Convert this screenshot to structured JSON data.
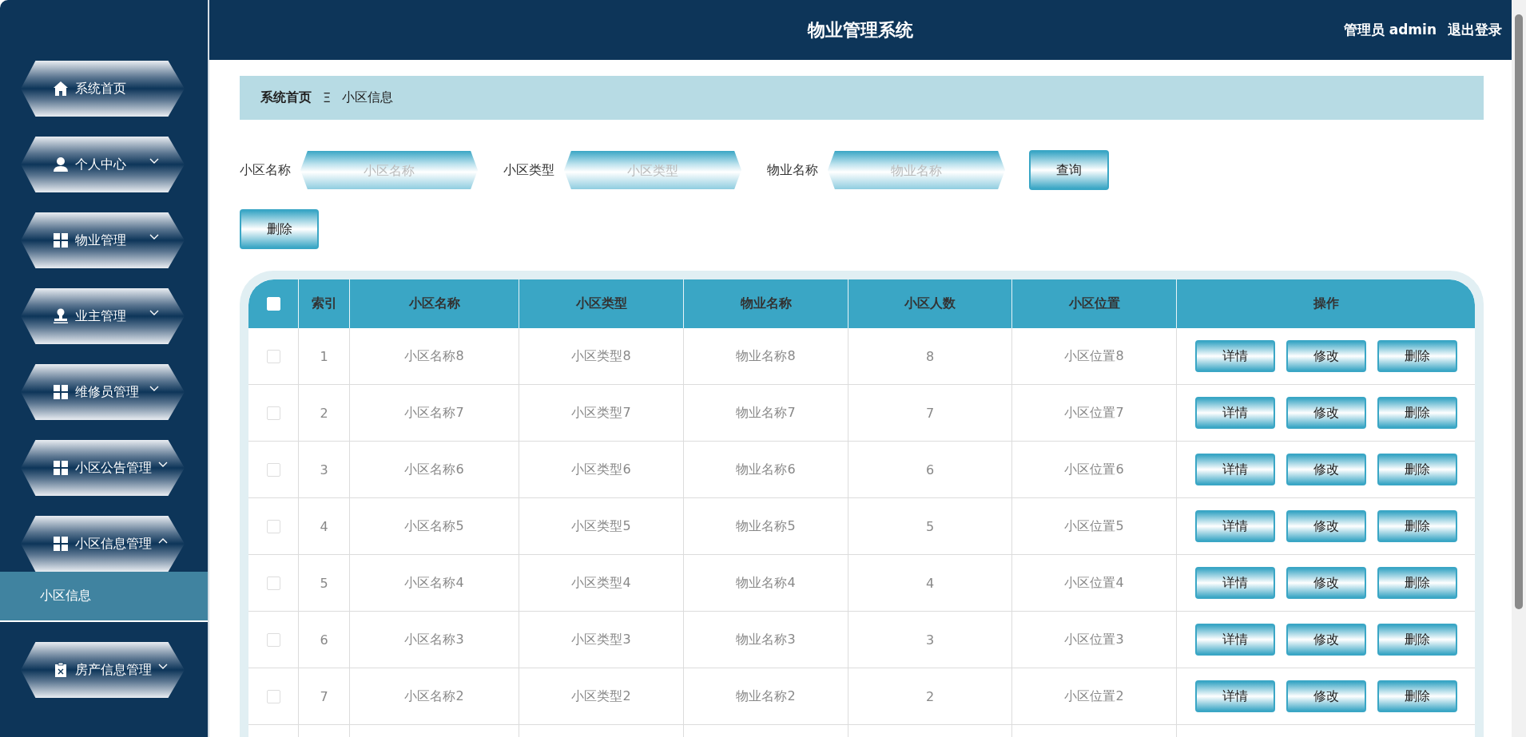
{
  "header": {
    "title": "物业管理系统",
    "user": "管理员 admin",
    "logout": "退出登录"
  },
  "sidebar": {
    "items": [
      {
        "label": "系统首页",
        "kind": "home"
      },
      {
        "label": "个人中心",
        "kind": "user",
        "expanded": false
      },
      {
        "label": "物业管理",
        "kind": "grid",
        "expanded": false
      },
      {
        "label": "业主管理",
        "kind": "stamp",
        "expanded": false
      },
      {
        "label": "维修员管理",
        "kind": "grid",
        "expanded": false
      },
      {
        "label": "小区公告管理",
        "kind": "grid",
        "expanded": false
      },
      {
        "label": "小区信息管理",
        "kind": "grid",
        "expanded": true,
        "children": [
          {
            "label": "小区信息",
            "selected": true
          }
        ]
      },
      {
        "label": "房产信息管理",
        "kind": "clipboard",
        "expanded": false
      }
    ]
  },
  "breadcrumb": {
    "home": "系统首页",
    "separator": "Ξ",
    "current": "小区信息"
  },
  "search": {
    "fields": [
      {
        "label": "小区名称",
        "placeholder": "小区名称"
      },
      {
        "label": "小区类型",
        "placeholder": "小区类型"
      },
      {
        "label": "物业名称",
        "placeholder": "物业名称"
      }
    ],
    "button": "查询"
  },
  "delete_button": "删除",
  "table": {
    "select_all_checked": false,
    "columns": [
      "索引",
      "小区名称",
      "小区类型",
      "物业名称",
      "小区人数",
      "小区位置",
      "操作"
    ],
    "rows": [
      {
        "checked": false,
        "cells": [
          "1",
          "小区名称8",
          "小区类型8",
          "物业名称8",
          "8",
          "小区位置8"
        ],
        "actions": [
          "详情",
          "修改",
          "删除"
        ]
      },
      {
        "checked": false,
        "cells": [
          "2",
          "小区名称7",
          "小区类型7",
          "物业名称7",
          "7",
          "小区位置7"
        ],
        "actions": [
          "详情",
          "修改",
          "删除"
        ]
      },
      {
        "checked": false,
        "cells": [
          "3",
          "小区名称6",
          "小区类型6",
          "物业名称6",
          "6",
          "小区位置6"
        ],
        "actions": [
          "详情",
          "修改",
          "删除"
        ]
      },
      {
        "checked": false,
        "cells": [
          "4",
          "小区名称5",
          "小区类型5",
          "物业名称5",
          "5",
          "小区位置5"
        ],
        "actions": [
          "详情",
          "修改",
          "删除"
        ]
      },
      {
        "checked": false,
        "cells": [
          "5",
          "小区名称4",
          "小区类型4",
          "物业名称4",
          "4",
          "小区位置4"
        ],
        "actions": [
          "详情",
          "修改",
          "删除"
        ]
      },
      {
        "checked": false,
        "cells": [
          "6",
          "小区名称3",
          "小区类型3",
          "物业名称3",
          "3",
          "小区位置3"
        ],
        "actions": [
          "详情",
          "修改",
          "删除"
        ]
      },
      {
        "checked": false,
        "cells": [
          "7",
          "小区名称2",
          "小区类型2",
          "物业名称2",
          "2",
          "小区位置2"
        ],
        "actions": [
          "详情",
          "修改",
          "删除"
        ]
      }
    ]
  }
}
